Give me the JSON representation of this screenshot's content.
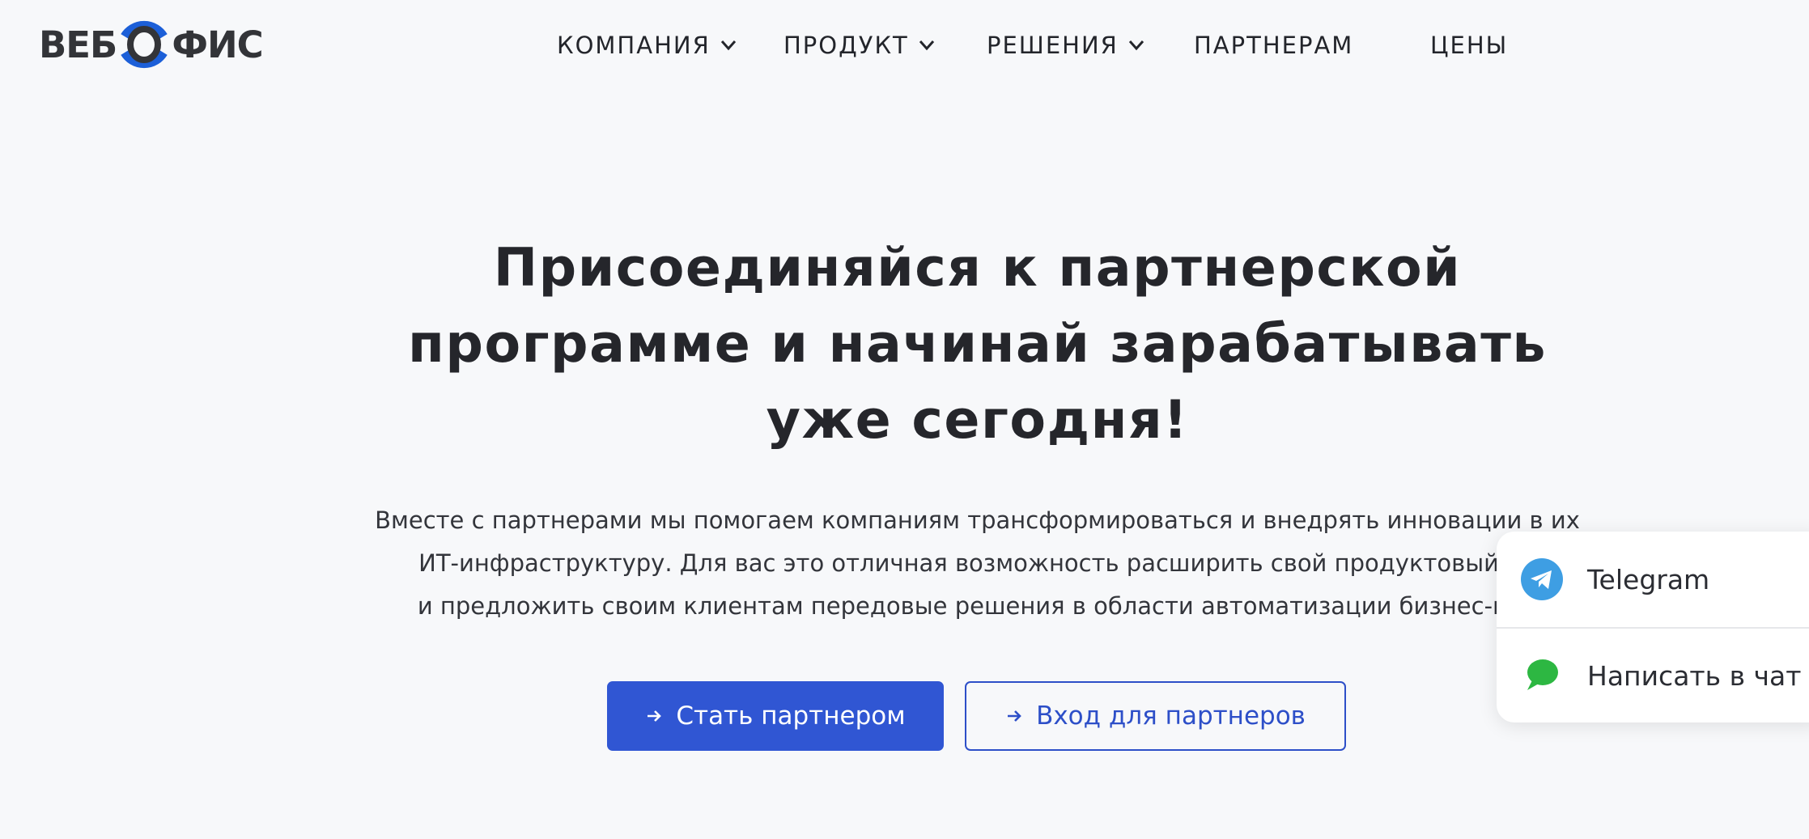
{
  "header": {
    "logo": {
      "left": "ВЕБ",
      "right": "ФИС"
    },
    "nav": [
      {
        "label": "КОМПАНИЯ",
        "dropdown": true
      },
      {
        "label": "ПРОДУКТ",
        "dropdown": true
      },
      {
        "label": "РЕШЕНИЯ",
        "dropdown": true
      },
      {
        "label": "ПАРТНЕРАМ",
        "dropdown": false
      },
      {
        "label": "ЦЕНЫ",
        "dropdown": false
      }
    ]
  },
  "hero": {
    "title_line1": "Присоединяйся к партнерской",
    "title_line2": "программе и начинай зарабатывать",
    "title_line3": "уже сегодня!",
    "text_line1": "Вместе с партнерами мы помогаем компаниям трансформироваться и внедрять инновации в их",
    "text_line2": "ИТ-инфраструктуру. Для вас это отличная возможность расширить свой продуктовый по",
    "text_line3": "и предложить своим клиентам передовые решения в области автоматизации бизнес-про",
    "primary_button": "Стать партнером",
    "secondary_button": "Вход для партнеров"
  },
  "chat_widget": {
    "telegram_label": "Telegram",
    "chat_label": "Написать в чат"
  },
  "colors": {
    "accent": "#3056d3",
    "logo_blue": "#1c5fd8",
    "telegram": "#3e9ee3",
    "chat_green": "#2db742",
    "background": "#f7f8fa"
  }
}
